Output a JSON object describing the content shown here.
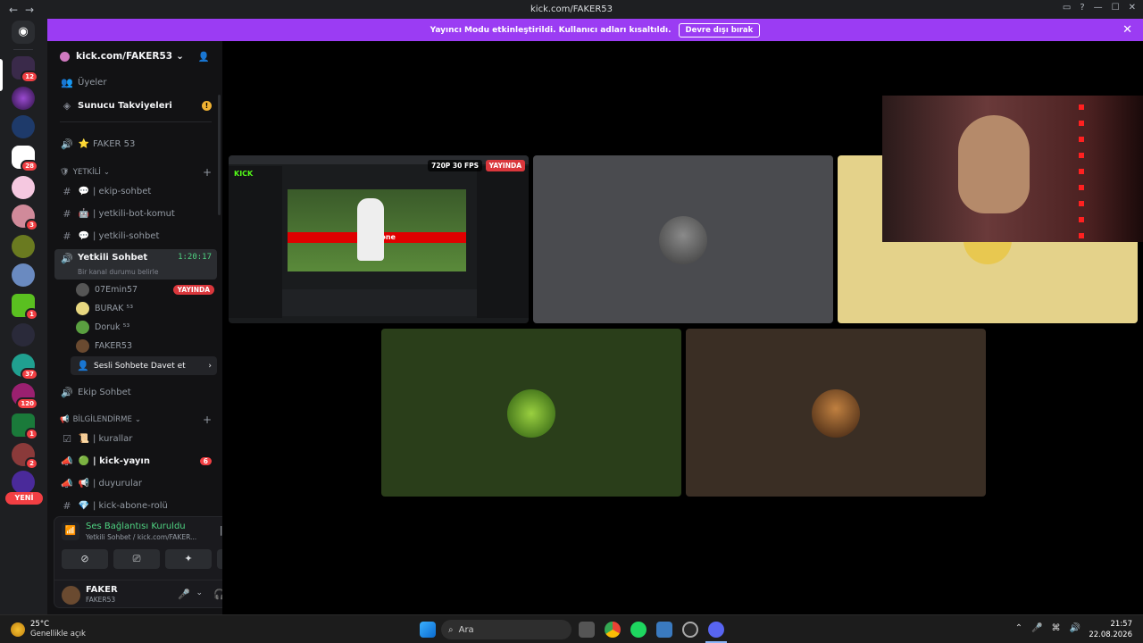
{
  "window": {
    "url": "kick.com/FAKER53"
  },
  "banner": {
    "text": "Yayıncı Modu etkinleştirildi. Kullanıcı adları kısaltıldı.",
    "button": "Devre dışı bırak"
  },
  "rail": {
    "new_label": "YENİ",
    "badges": [
      "12",
      "28",
      "3",
      "1",
      "37",
      "120",
      "1",
      "2"
    ]
  },
  "guild": {
    "name": "kick.com/FAKER53"
  },
  "sidebar": {
    "members_label": "Üyeler",
    "boost_label": "Sunucu Takviyeleri",
    "top_voice": "FAKER 53",
    "cat_yetkili": "YETKİLİ",
    "ch_ekip_sohbet": "| ekip-sohbet",
    "ch_bot_komut": "| yetkili-bot-komut",
    "ch_yetkili_sohbet": "| yetkili-sohbet",
    "voice_active": "Yetkili Sohbet",
    "voice_timer": "1:20:17",
    "voice_status": "Bir kanal durumu belirle",
    "members": [
      {
        "name": "07Emin57",
        "live": "YAYINDA"
      },
      {
        "name": "BURAK ⁵³"
      },
      {
        "name": "Doruk ⁵³"
      },
      {
        "name": "FAKER53"
      }
    ],
    "invite": "Sesli Sohbete Davet et",
    "voice_ekip": "Ekip Sohbet",
    "cat_bilgi": "BİLGİLENDİRME",
    "ch_kurallar": "| kurallar",
    "ch_kick_yayin": "| kick-yayın",
    "kick_yayin_badge": "6",
    "ch_duyurular": "| duyurular",
    "ch_abone": "| kick-abone-rolü"
  },
  "voice_panel": {
    "status": "Ses Bağlantısı Kuruldu",
    "channel": "Yetkili Sohbet / kick.com/FAKER..."
  },
  "user": {
    "name": "FAKER",
    "sub": "FAKER53"
  },
  "stage": {
    "stream_quality": "720P 30 FPS",
    "stream_live": "YAYINDA",
    "stream_brand": "KICK",
    "ad_text": "vodafone"
  },
  "taskbar": {
    "temp": "25°C",
    "weather": "Genellikle açık",
    "search": "Ara",
    "time": "21:57",
    "date": "22.08.2026"
  }
}
